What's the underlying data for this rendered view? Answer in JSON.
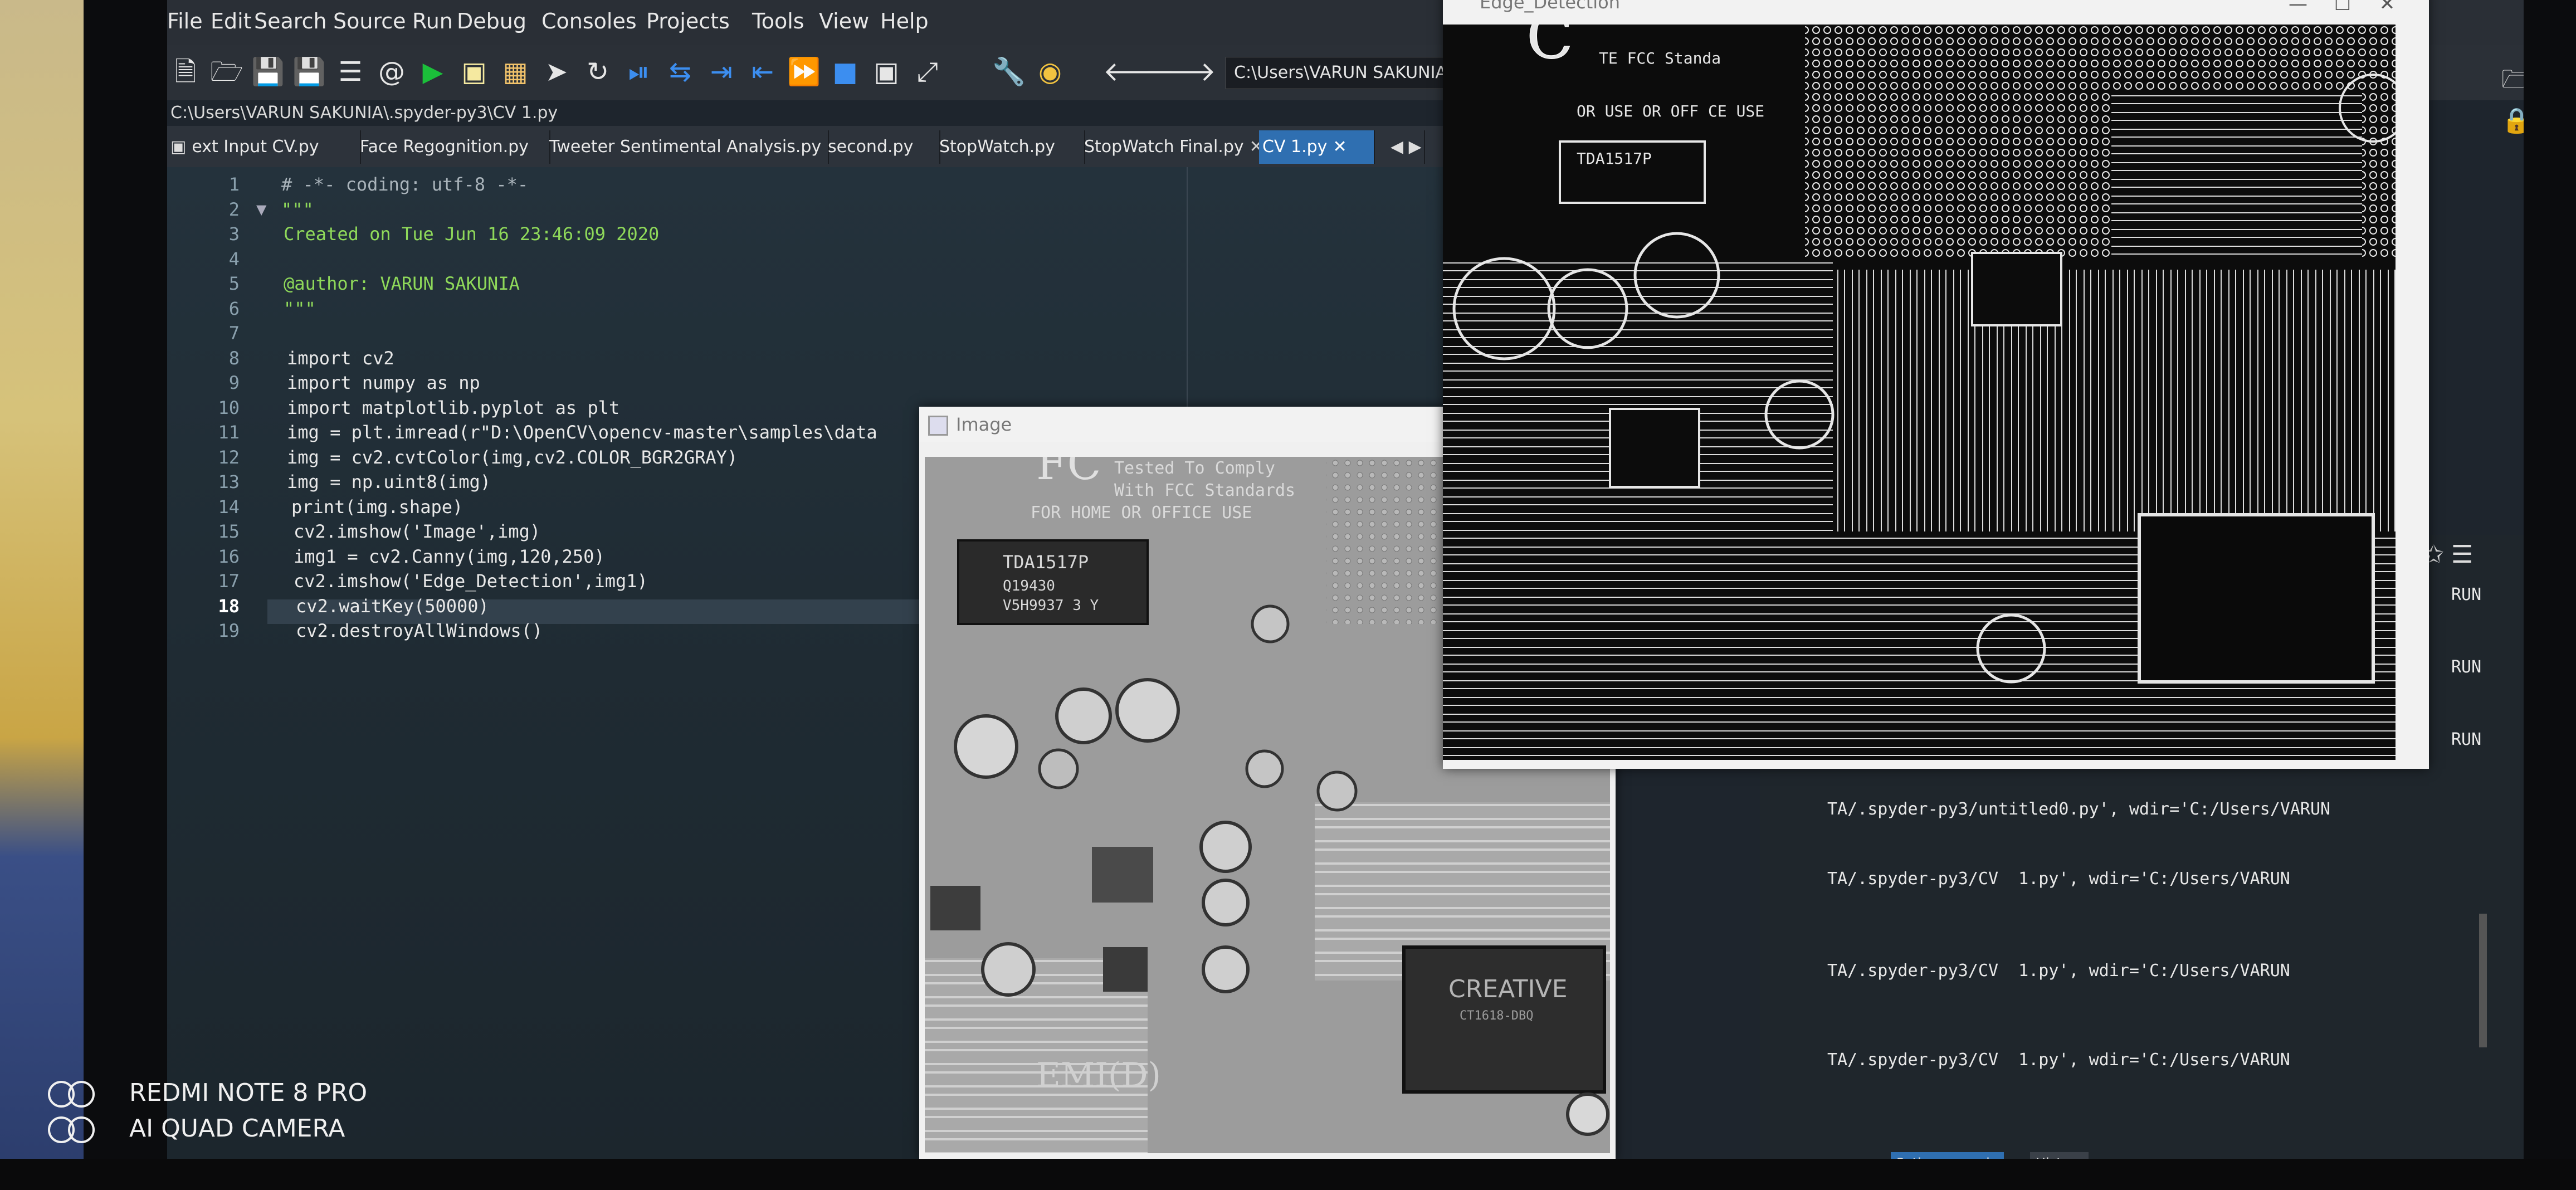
{
  "menu": [
    "File",
    "Edit",
    "Search",
    "Source",
    "Run",
    "Debug",
    "Consoles",
    "Projects",
    "Tools",
    "View",
    "Help"
  ],
  "toolbar": {
    "path_value": "C:\\Users\\VARUN SAKUNIA\\.s",
    "icons": [
      "new-file",
      "open-file",
      "save",
      "save-all",
      "outline",
      "at-sign",
      "run",
      "run-cell",
      "run-cell-advance",
      "run-selection",
      "re-run",
      "debug",
      "step",
      "step-into",
      "step-return",
      "continue",
      "stop",
      "maximize",
      "fullscreen",
      "preferences",
      "python-path",
      "back",
      "forward"
    ]
  },
  "file_path": "C:\\Users\\VARUN SAKUNIA\\.spyder-py3\\CV  1.py",
  "tabs": [
    {
      "label": "ext Input CV.py"
    },
    {
      "label": "Face Regognition.py"
    },
    {
      "label": "Tweeter Sentimental Analysis.py"
    },
    {
      "label": "second.py"
    },
    {
      "label": "StopWatch.py"
    },
    {
      "label": "StopWatch Final.py"
    },
    {
      "label": "CV  1.py"
    }
  ],
  "editor": {
    "line_numbers": [
      "1",
      "2",
      "3",
      "4",
      "5",
      "6",
      "7",
      "8",
      "9",
      "10",
      "11",
      "12",
      "13",
      "14",
      "15",
      "16",
      "17",
      "18",
      "19"
    ],
    "current_line": "18",
    "lines": [
      "# -*- coding: utf-8 -*-",
      "\"\"\"",
      "Created on Tue Jun 16 23:46:09 2020",
      "",
      "@author: VARUN SAKUNIA",
      "\"\"\"",
      "",
      "import cv2",
      "import numpy as np",
      "import matplotlib.pyplot as plt",
      "img = plt.imread(r\"D:\\OpenCV\\opencv-master\\samples\\data",
      "img = cv2.cvtColor(img,cv2.COLOR_BGR2GRAY)",
      "img = np.uint8(img)",
      "print(img.shape)",
      "cv2.imshow('Image',img)",
      "img1 = cv2.Canny(img,120,250)",
      "cv2.imshow('Edge_Detection',img1)",
      "cv2.waitKey(50000)",
      "cv2.destroyAllWindows()"
    ]
  },
  "console": {
    "truncated_top": [
      "RUN",
      "RUN",
      "RUN"
    ],
    "lines": [
      "TA/.spyder-py3/untitled0.py', wdir='C:/Users/VARUN",
      "TA/.spyder-py3/CV  1.py', wdir='C:/Users/VARUN",
      "TA/.spyder-py3/CV  1.py', wdir='C:/Users/VARUN",
      "TA/.spyder-py3/CV  1.py', wdir='C:/Users/VARUN"
    ],
    "tabs": [
      "Python console",
      "History"
    ]
  },
  "image_window": {
    "title": "Image",
    "board_text": {
      "fcc_tested": "Tested To Comply",
      "fcc_standards": "With FCC Standards",
      "home_office": "FOR HOME OR OFFICE USE",
      "chip1": "TDA1517P",
      "chip1_b": "Q19430",
      "chip1_c": "V5H9937 3 Y",
      "creative": "CREATIVE",
      "creative_b": "CT1618-DBQ",
      "emi": "EMI(D)"
    }
  },
  "edge_window": {
    "title": "Edge_Detection",
    "board_text": {
      "line1": "TE FCC Standa",
      "line2": "OR  USE OR OFF CE USE",
      "chip": "TDA1517P"
    }
  },
  "watermark": {
    "line1": "REDMI NOTE 8 PRO",
    "line2": "AI QUAD CAMERA"
  },
  "colors": {
    "accent_tab": "#2f6fb1",
    "keyword": "#f1ee8b",
    "docstring": "#8fd95a",
    "number": "#ffb45a"
  }
}
